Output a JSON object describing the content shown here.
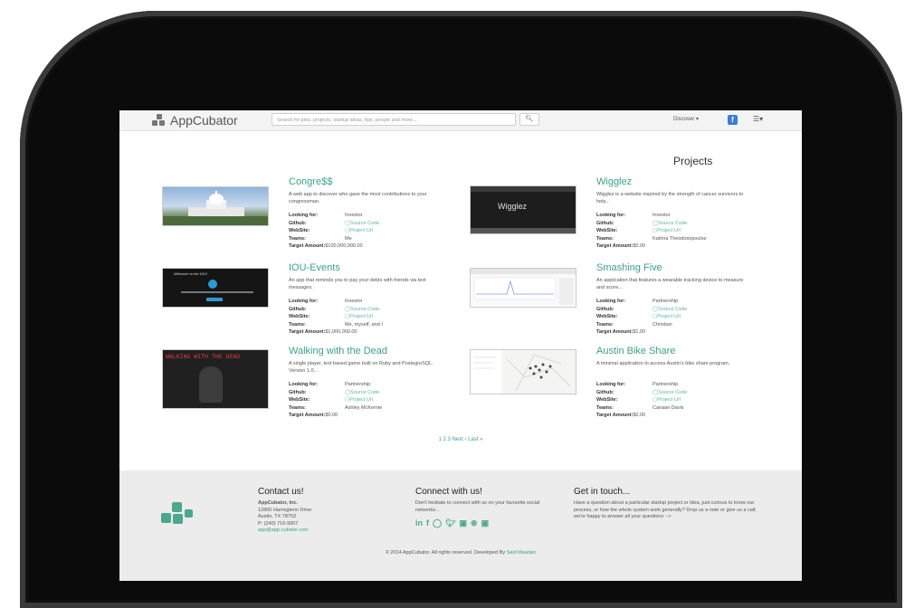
{
  "navbar": {
    "brand": "AppCubator",
    "search_placeholder": "Search for jobs, projects, startup ideas, tips, people and more....",
    "search_button": "🔍︎",
    "discover": "Discover ▾",
    "fb": "f",
    "menu": "☰▾"
  },
  "section_title": "Projects",
  "labels": {
    "looking_for": "Looking for:",
    "github": "Github:",
    "website": "WebSite:",
    "teams": "Teams:",
    "target": "Target Amount:"
  },
  "projects": [
    {
      "title": "Congre$$",
      "desc": "A web app to discover who gave the most contributions to your congressman.",
      "looking_for": "Investor",
      "github": "Source Code",
      "website": "Project Url",
      "teams": "Me",
      "target": "$100,000,000.00",
      "thumb_icon": "capitol-icon"
    },
    {
      "title": "Wigglez",
      "desc": "Wigglez is a website inspired by the strength of cancer survivors to help...",
      "looking_for": "Investor",
      "github": "Source Code",
      "website": "Project Url",
      "teams": "Katrina Theodosopoulos",
      "target": "$0.00",
      "thumb_text": "Wigglez"
    },
    {
      "title": "IOU-Events",
      "desc": "An app that reminds you to pay your debts with friends via text messages.",
      "looking_for": "Investor",
      "github": "Source Code",
      "website": "Project Url",
      "teams": "Me, myself, and I",
      "target": "$1,000,000.00",
      "thumb_text": "Welcome to the IOU!"
    },
    {
      "title": "Smashing Five",
      "desc": "An application that features a wearable tracking device to measure and score...",
      "looking_for": "Partnership",
      "github": "Source Code",
      "website": "Project Url",
      "teams": "Christian",
      "target": "$1.00",
      "thumb_icon": "chart-icon"
    },
    {
      "title": "Walking with the Dead",
      "desc": "A single player, text based game built on Ruby and PostegreSQL. Version 1.0...",
      "looking_for": "Partnership",
      "github": "Source Code",
      "website": "Project Url",
      "teams": "Ashley McKernie",
      "target": "$0.00",
      "thumb_text": "WALKING WITH THE DEAD"
    },
    {
      "title": "Austin Bike Share",
      "desc": "A minimal application to access Austin's bike share program.",
      "looking_for": "Partnership",
      "github": "Source Code",
      "website": "Project Url",
      "teams": "Canaan Davis",
      "target": "$0.00",
      "thumb_icon": "map-icon"
    }
  ],
  "pager": "1 2 3 Next › Last »",
  "footer": {
    "contact": {
      "title": "Contact us!",
      "company": "AppCubator, Inc.",
      "street": "12800 Harrisglenn Drive",
      "city": "Austin, TX 78753",
      "phone": "P: (240) 716-9907",
      "email": "app@app-cubator.com"
    },
    "connect": {
      "title": "Connect with us!",
      "text": "Don't hesitate to connect with us on your favourite social networks...",
      "icons": [
        "in",
        "f",
        "◯",
        "🐦︎",
        "▣",
        "⊛",
        "▣"
      ]
    },
    "touch": {
      "title": "Get in touch...",
      "text": "Have a question about a particular startup project or idea, just curious to know our process, or how the whole system work generally? Drop us a note or give us a call; we're happy to answer all your questions -->"
    },
    "copyright": "© 2014 AppCubator. All rights reserved. Developed By",
    "developer": "Said Maadan"
  }
}
